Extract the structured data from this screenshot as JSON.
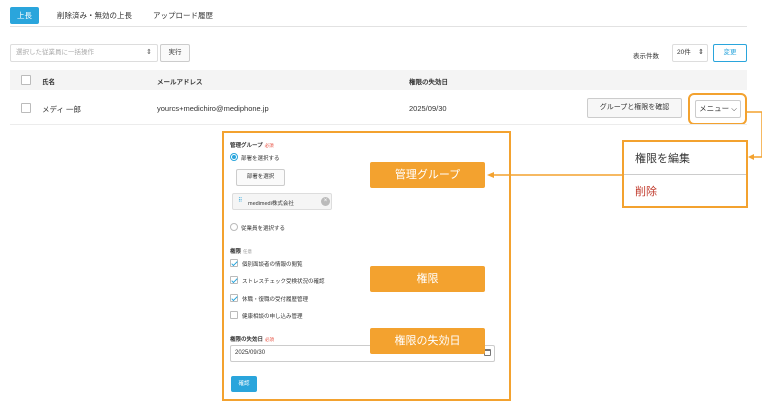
{
  "tabs": [
    {
      "label": "上長",
      "active": true
    },
    {
      "label": "削除済み・無効の上長",
      "active": false
    },
    {
      "label": "アップロード履歴",
      "active": false
    }
  ],
  "toolbar": {
    "bulk_placeholder": "選択した従業員に一括操作",
    "run_label": "実行",
    "count_label": "表示件数",
    "count_value": "20件",
    "change_label": "変更"
  },
  "table": {
    "headers": [
      "氏名",
      "メールアドレス",
      "権限の失効日"
    ],
    "rows": [
      {
        "name": "メディ 一郎",
        "email": "yourcs+medichiro@mediphone.jp",
        "expiry": "2025/09/30",
        "perm_button": "グループと権限を確認",
        "menu_button": "メニュー"
      }
    ]
  },
  "panel": {
    "group_label": "管理グループ",
    "required": "必須",
    "radio_dept": "部署を選択する",
    "select_dept_button": "部署を選択",
    "chip_text": "medimedi株式会社",
    "radio_employee": "従業員を選択する",
    "perm_label": "権限",
    "optional": "任意",
    "permissions": [
      {
        "label": "個別面談者の情報の閲覧",
        "checked": true
      },
      {
        "label": "ストレスチェック受検状況の確認",
        "checked": true
      },
      {
        "label": "休職・復職の受付履歴管理",
        "checked": true
      },
      {
        "label": "健康相談の申し込み管理",
        "checked": false
      }
    ],
    "expiry_label": "権限の失効日",
    "expiry_value": "2025/09/30",
    "confirm_label": "確認"
  },
  "callouts": {
    "group": "管理グループ",
    "perm": "権限",
    "expiry": "権限の失効日"
  },
  "menu": {
    "edit": "権限を編集",
    "delete": "削除"
  },
  "colors": {
    "accent": "#2aa5dc",
    "annotation": "#f3a22f",
    "danger": "#c0392b"
  }
}
